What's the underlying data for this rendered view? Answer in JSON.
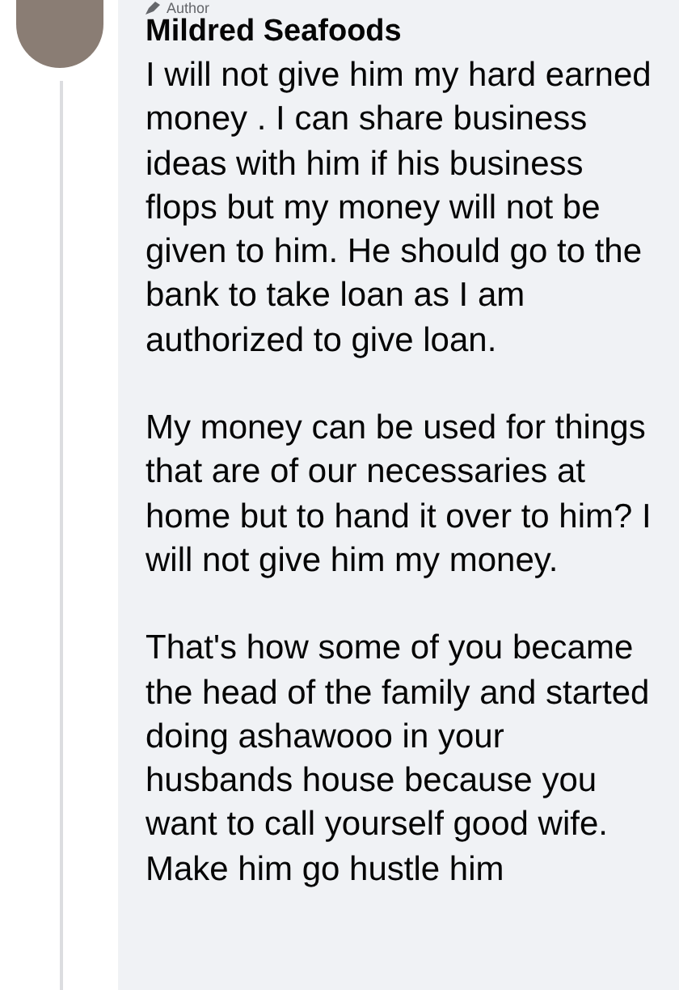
{
  "comment": {
    "badge": "Author",
    "author": "Mildred Seafoods",
    "paragraphs": [
      "I will not give him my hard earned money . I can share business ideas with him if his business flops but my money will not be given to him. He should go to the bank to take loan as I am authorized to give loan.",
      "My money can be used for things that are of our necessaries at home but to hand it over to him? I will not give him my money.",
      "That's how some of you became the head of the family and started doing ashawooo in your husbands house because you want to call yourself good wife. Make him go hustle him"
    ]
  }
}
